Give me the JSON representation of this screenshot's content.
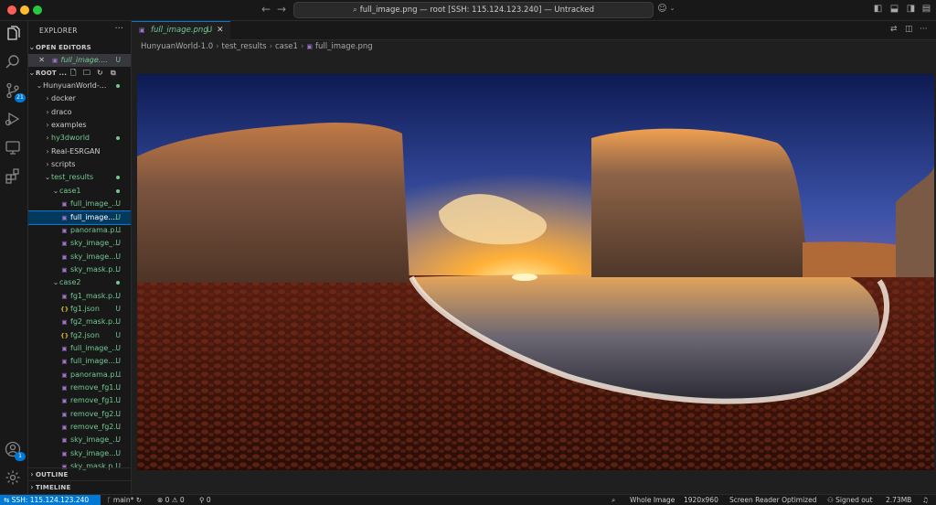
{
  "titlebar": {
    "command_center": "full_image.png — root [SSH: 115.124.123.240] — Untracked",
    "colors": {
      "close": "#ff5f57",
      "minimize": "#febc2e",
      "maximize": "#28c840"
    }
  },
  "activity": {
    "source_control_badge": "21",
    "accounts_badge": "1"
  },
  "sidebar": {
    "title": "EXPLORER",
    "open_editors": {
      "label": "OPEN EDITORS",
      "item": "full_image....",
      "status": "U"
    },
    "root_label": "ROOT ...",
    "tree": [
      {
        "label": "HunyuanWorld-...",
        "kind": "folder",
        "open": true,
        "depth": 0,
        "dot": true
      },
      {
        "label": "docker",
        "kind": "folder",
        "open": false,
        "depth": 1
      },
      {
        "label": "draco",
        "kind": "folder",
        "open": false,
        "depth": 1
      },
      {
        "label": "examples",
        "kind": "folder",
        "open": false,
        "depth": 1
      },
      {
        "label": "hy3dworld",
        "kind": "folder",
        "open": false,
        "depth": 1,
        "dot": true,
        "green": true
      },
      {
        "label": "Real-ESRGAN",
        "kind": "folder",
        "open": false,
        "depth": 1
      },
      {
        "label": "scripts",
        "kind": "folder",
        "open": false,
        "depth": 1
      },
      {
        "label": "test_results",
        "kind": "folder",
        "open": true,
        "depth": 1,
        "dot": true,
        "green": true
      },
      {
        "label": "case1",
        "kind": "folder",
        "open": true,
        "depth": 2,
        "dot": true,
        "green": true
      },
      {
        "label": "full_image_...",
        "kind": "image",
        "depth": 3,
        "status": "U"
      },
      {
        "label": "full_image....",
        "kind": "image",
        "depth": 3,
        "status": "U",
        "selected": true
      },
      {
        "label": "panorama.p...",
        "kind": "image",
        "depth": 3,
        "status": "U"
      },
      {
        "label": "sky_image_...",
        "kind": "image",
        "depth": 3,
        "status": "U"
      },
      {
        "label": "sky_image....",
        "kind": "image",
        "depth": 3,
        "status": "U"
      },
      {
        "label": "sky_mask.p...",
        "kind": "image",
        "depth": 3,
        "status": "U"
      },
      {
        "label": "case2",
        "kind": "folder",
        "open": true,
        "depth": 2,
        "dot": true,
        "green": true
      },
      {
        "label": "fg1_mask.p...",
        "kind": "image",
        "depth": 3,
        "status": "U"
      },
      {
        "label": "fg1.json",
        "kind": "json",
        "depth": 3,
        "status": "U"
      },
      {
        "label": "fg2_mask.p...",
        "kind": "image",
        "depth": 3,
        "status": "U"
      },
      {
        "label": "fg2.json",
        "kind": "json",
        "depth": 3,
        "status": "U"
      },
      {
        "label": "full_image_...",
        "kind": "image",
        "depth": 3,
        "status": "U"
      },
      {
        "label": "full_image....",
        "kind": "image",
        "depth": 3,
        "status": "U"
      },
      {
        "label": "panorama.p...",
        "kind": "image",
        "depth": 3,
        "status": "U"
      },
      {
        "label": "remove_fg1...",
        "kind": "image",
        "depth": 3,
        "status": "U"
      },
      {
        "label": "remove_fg1...",
        "kind": "image",
        "depth": 3,
        "status": "U"
      },
      {
        "label": "remove_fg2...",
        "kind": "image",
        "depth": 3,
        "status": "U"
      },
      {
        "label": "remove_fg2...",
        "kind": "image",
        "depth": 3,
        "status": "U"
      },
      {
        "label": "sky_image_...",
        "kind": "image",
        "depth": 3,
        "status": "U"
      },
      {
        "label": "sky_image....",
        "kind": "image",
        "depth": 3,
        "status": "U"
      },
      {
        "label": "sky_mask.p...",
        "kind": "image",
        "depth": 3,
        "status": "U"
      }
    ],
    "outline_label": "OUTLINE",
    "timeline_label": "TIMELINE"
  },
  "editor": {
    "tab_label": "full_image.png",
    "tab_status": "U",
    "breadcrumb": [
      "HunyuanWorld-1.0",
      "test_results",
      "case1",
      "full_image.png"
    ]
  },
  "status": {
    "remote": "SSH: 115.124.123.240",
    "branch": "main*",
    "problems": "⊗ 0 ⚠ 0",
    "ports": "0",
    "zoom": "Whole Image",
    "dimensions": "1920x960",
    "screen_reader": "Screen Reader Optimized",
    "signed_out": "Signed out",
    "file_size": "2.73MB"
  }
}
